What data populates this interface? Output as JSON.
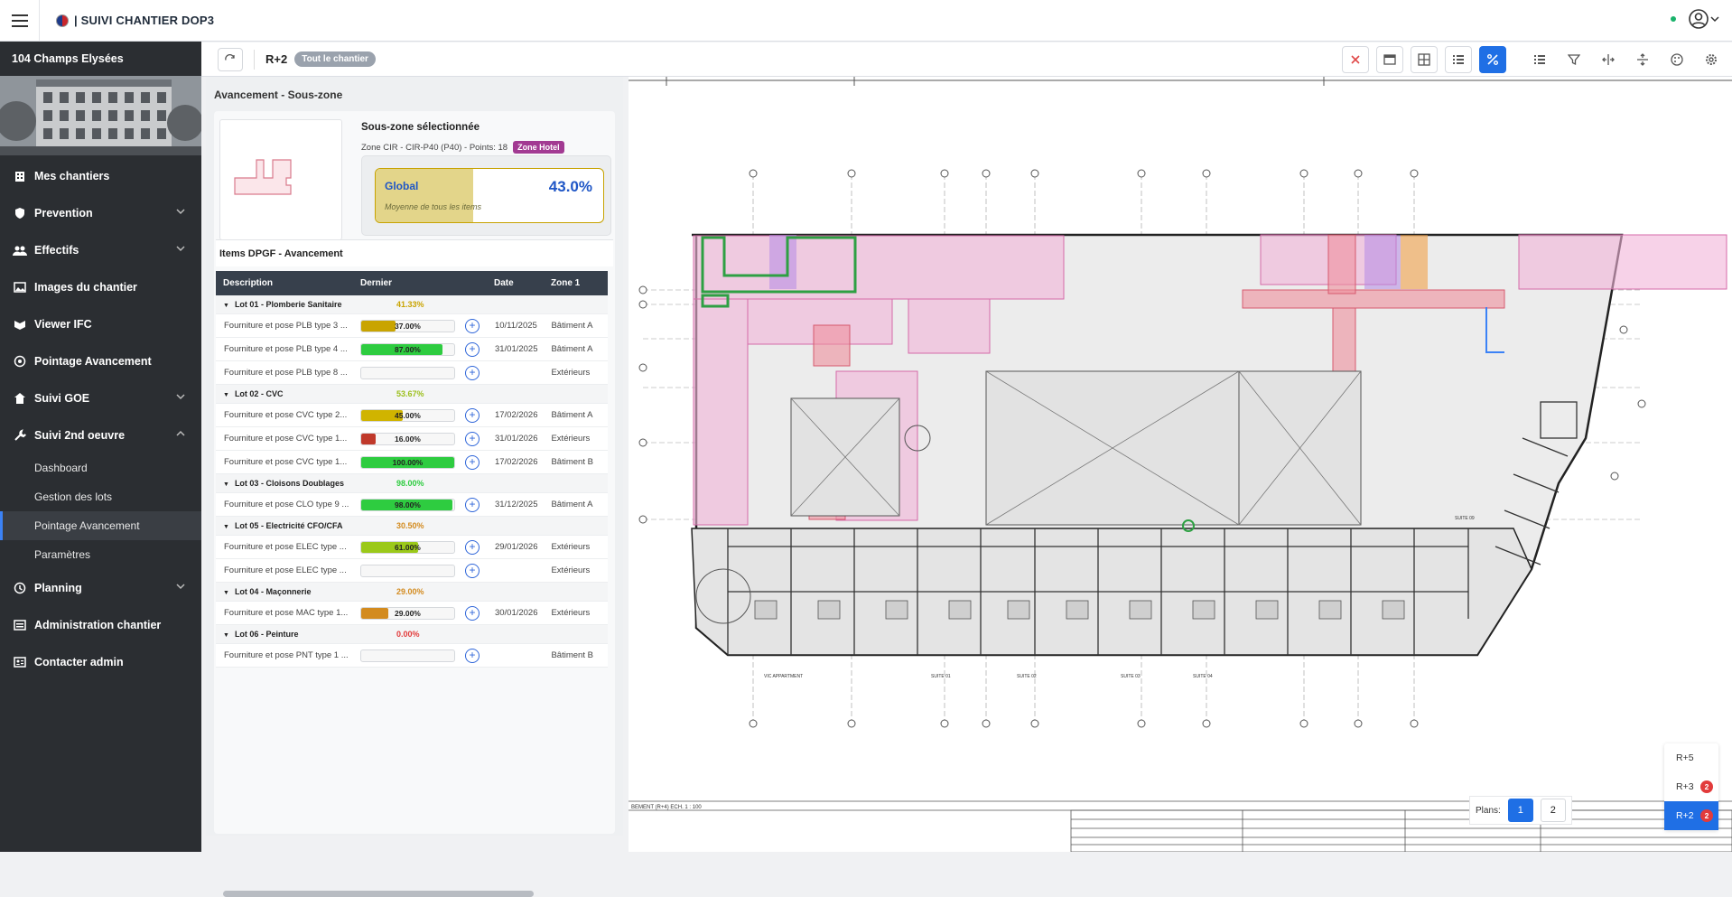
{
  "app": {
    "title": "| SUIVI CHANTIER DOP3"
  },
  "sidebar": {
    "site_name": "104 Champs Elysées",
    "items": [
      {
        "label": "Mes chantiers",
        "icon": "building-icon",
        "chevron": false
      },
      {
        "label": "Prevention",
        "icon": "shield-icon",
        "chevron": true
      },
      {
        "label": "Effectifs",
        "icon": "users-icon",
        "chevron": true
      },
      {
        "label": "Images du chantier",
        "icon": "image-icon",
        "chevron": false
      },
      {
        "label": "Viewer IFC",
        "icon": "viewer-icon",
        "chevron": false
      },
      {
        "label": "Pointage Avancement",
        "icon": "target-icon",
        "chevron": false
      },
      {
        "label": "Suivi GOE",
        "icon": "home-icon",
        "chevron": true
      },
      {
        "label": "Suivi 2nd oeuvre",
        "icon": "tools-icon",
        "chevron": true,
        "expanded": true
      },
      {
        "label": "Planning",
        "icon": "clock-icon",
        "chevron": true
      },
      {
        "label": "Administration chantier",
        "icon": "list-icon",
        "chevron": false
      },
      {
        "label": "Contacter admin",
        "icon": "contact-icon",
        "chevron": false
      }
    ],
    "subitems": [
      "Dashboard",
      "Gestion des lots",
      "Pointage Avancement",
      "Paramètres"
    ],
    "active_subitem": "Pointage Avancement"
  },
  "toolbar": {
    "level": "R+2",
    "scope_pill": "Tout le chantier"
  },
  "panel": {
    "title": "Avancement - Sous-zone",
    "selected_title": "Sous-zone sélectionnée",
    "selected_info": "Zone CIR - CIR-P40 (P40) - Points: 18",
    "zone_badge": "Zone Hotel",
    "global": {
      "label": "Global",
      "sub": "Moyenne de tous les items",
      "pct": "43.0%",
      "value": 43.0
    },
    "items_title": "Items DPGF - Avancement",
    "columns": [
      "Description",
      "Dernier",
      "Date",
      "Zone 1"
    ],
    "groups": [
      {
        "name": "Lot 01 - Plomberie Sanitaire",
        "pct": "41.33%",
        "pct_color": "#c9a400",
        "rows": [
          {
            "desc": "Fourniture et pose PLB type 3 ...",
            "pct": "37.00%",
            "value": 37,
            "color": "#c9a400",
            "date": "10/11/2025",
            "zone": "Bâtiment A"
          },
          {
            "desc": "Fourniture et pose PLB type 4 ...",
            "pct": "87.00%",
            "value": 87,
            "color": "#2ecc40",
            "date": "31/01/2025",
            "zone": "Bâtiment A"
          },
          {
            "desc": "Fourniture et pose PLB type 8 ...",
            "pct": "",
            "value": 0,
            "color": "#2ecc40",
            "date": "",
            "zone": "Extérieurs"
          }
        ]
      },
      {
        "name": "Lot 02 - CVC",
        "pct": "53.67%",
        "pct_color": "#9bbf1a",
        "rows": [
          {
            "desc": "Fourniture et pose CVC type 2...",
            "pct": "45.00%",
            "value": 45,
            "color": "#d0b400",
            "date": "17/02/2026",
            "zone": "Bâtiment A"
          },
          {
            "desc": "Fourniture et pose CVC type 1...",
            "pct": "16.00%",
            "value": 16,
            "color": "#c0392b",
            "date": "31/01/2026",
            "zone": "Extérieurs"
          },
          {
            "desc": "Fourniture et pose CVC type 1...",
            "pct": "100.00%",
            "value": 100,
            "color": "#2ecc40",
            "date": "17/02/2026",
            "zone": "Bâtiment B"
          }
        ]
      },
      {
        "name": "Lot 03 - Cloisons Doublages",
        "pct": "98.00%",
        "pct_color": "#2ecc40",
        "rows": [
          {
            "desc": "Fourniture et pose CLO type 9 ...",
            "pct": "98.00%",
            "value": 98,
            "color": "#2ecc40",
            "date": "31/12/2025",
            "zone": "Bâtiment A"
          }
        ]
      },
      {
        "name": "Lot 05 - Electricité CFO/CFA",
        "pct": "30.50%",
        "pct_color": "#d38b1f",
        "rows": [
          {
            "desc": "Fourniture et pose ELEC type ...",
            "pct": "61.00%",
            "value": 61,
            "color": "#9bc91a",
            "date": "29/01/2026",
            "zone": "Extérieurs"
          },
          {
            "desc": "Fourniture et pose ELEC type ...",
            "pct": "",
            "value": 0,
            "color": "#2ecc40",
            "date": "",
            "zone": "Extérieurs"
          }
        ]
      },
      {
        "name": "Lot 04 - Maçonnerie",
        "pct": "29.00%",
        "pct_color": "#d38b1f",
        "rows": [
          {
            "desc": "Fourniture et pose MAC type 1...",
            "pct": "29.00%",
            "value": 29,
            "color": "#d38b1f",
            "date": "30/01/2026",
            "zone": "Extérieurs"
          }
        ]
      },
      {
        "name": "Lot 06 - Peinture",
        "pct": "0.00%",
        "pct_color": "#e23b3b",
        "rows": [
          {
            "desc": "Fourniture et pose PNT type 1 ...",
            "pct": "",
            "value": 0,
            "color": "#2ecc40",
            "date": "",
            "zone": "Bâtiment B"
          }
        ]
      }
    ]
  },
  "plan": {
    "title_block": "BEMENT (R+4)     ECH. 1 : 100",
    "labels": [
      "VIC APPARTMENT",
      "SUITE 01",
      "SUITE 02",
      "SUITE 03",
      "SUITE 04",
      "SUITE 09"
    ]
  },
  "plans_ctrl": {
    "label": "Plans:",
    "pages": [
      "1",
      "2"
    ],
    "active": "1"
  },
  "levels": [
    {
      "name": "R+5",
      "count": ""
    },
    {
      "name": "R+3",
      "count": "2"
    },
    {
      "name": "R+2",
      "count": "2",
      "active": true
    }
  ]
}
